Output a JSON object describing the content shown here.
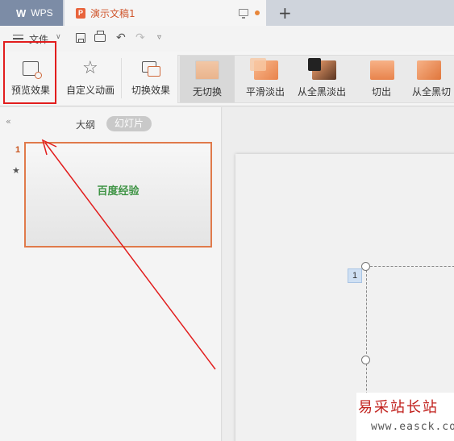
{
  "titlebar": {
    "app_tab": "WPS",
    "doc_tab": "演示文稿1",
    "new_tab_symbol": "+"
  },
  "quickbar": {
    "file_menu": "文件"
  },
  "ribbon": {
    "preview": "预览效果",
    "custom_animation": "自定义动画",
    "switch_effect": "切换效果",
    "transitions": [
      "无切换",
      "平滑淡出",
      "从全黑淡出",
      "切出",
      "从全黑切"
    ]
  },
  "leftpanel": {
    "tab_outline": "大纲",
    "tab_slides": "幻灯片",
    "slide_number": "1",
    "slide_title": "百度经验"
  },
  "editor": {
    "placeholder_number": "1"
  },
  "watermark": {
    "title": "易采站长站",
    "url": "www.easck.com"
  },
  "colors": {
    "accent": "#e07a4b",
    "highlight": "#e21d1d",
    "slide_title": "#3f9445"
  }
}
